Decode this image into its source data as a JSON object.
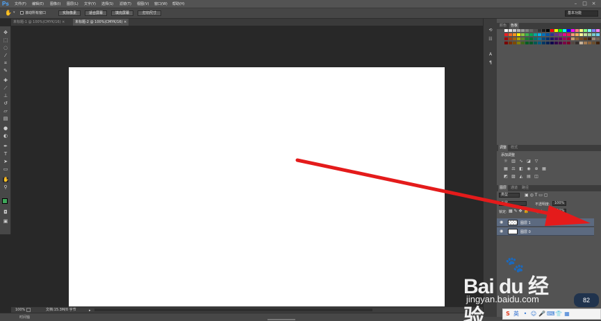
{
  "app": {
    "logo": "Ps",
    "menu": [
      "文件(F)",
      "编辑(E)",
      "图像(I)",
      "图层(L)",
      "文字(Y)",
      "选择(S)",
      "滤镜(T)",
      "视图(V)",
      "窗口(W)",
      "帮助(H)"
    ],
    "window_controls": [
      "–",
      "□",
      "×"
    ]
  },
  "options_bar": {
    "scroll_all_windows": "滚动所有窗口",
    "actual_pixels": "实际像素",
    "fit_screen": "适合屏幕",
    "fill_screen": "填充屏幕",
    "print_size": "打印尺寸",
    "workspace": "基本功能"
  },
  "tabs": [
    {
      "label": "未标题-1 @ 100%(CMYK/16)",
      "close": "×"
    },
    {
      "label": "未标题-2 @ 100%(CMYK/16)",
      "close": "×"
    }
  ],
  "status": {
    "zoom": "100%",
    "doc_info": "文档:15.3M/0 字节",
    "bottom_text": "时间轴"
  },
  "panels": {
    "swatches_tabs": [
      "颜色",
      "色板"
    ],
    "adjust_tabs": [
      "调整",
      "样式"
    ],
    "adjust_title": "添加调整",
    "layers_tabs": [
      "图层",
      "通道",
      "路径"
    ],
    "kind_label": "类型",
    "blend_mode": "正常",
    "opacity_label": "不透明度:",
    "opacity_value": "100%",
    "lock_label": "锁定:",
    "fill_label": "填充:",
    "fill_value": "100%",
    "layers": [
      {
        "name": "图层 1",
        "thumb": "transparent"
      },
      {
        "name": "图层 0",
        "thumb": "white"
      }
    ]
  },
  "annotation": {
    "arrow_color": "#e41b1b"
  },
  "watermark": {
    "brand": "Bai du 经验",
    "url": "jingyan.baidu.com"
  },
  "taskbar": {
    "ime": "英",
    "badge": "82"
  },
  "colors": {
    "foreground": "#3fa85a",
    "background": "#000000"
  }
}
